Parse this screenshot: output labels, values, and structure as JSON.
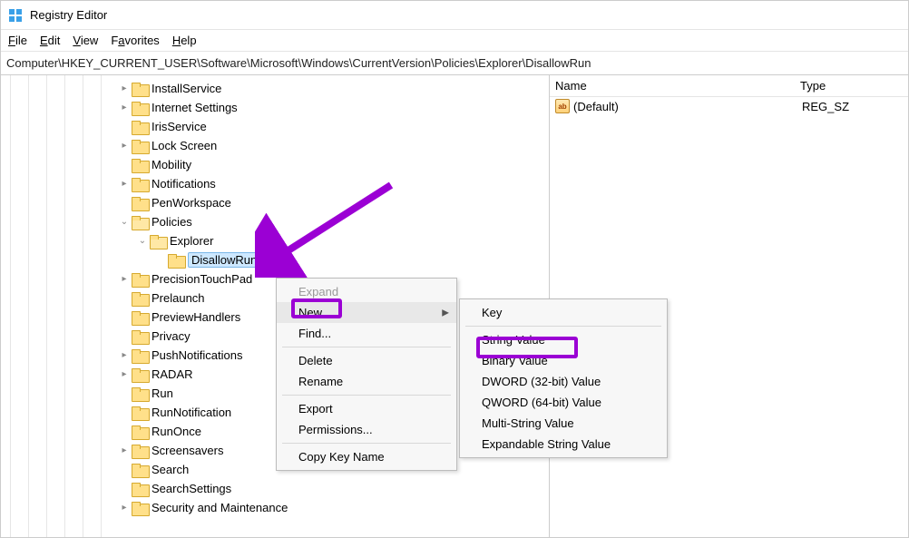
{
  "window": {
    "title": "Registry Editor"
  },
  "menubar": {
    "file": "File",
    "edit": "Edit",
    "view": "View",
    "favorites": "Favorites",
    "help": "Help"
  },
  "addressbar": {
    "path": "Computer\\HKEY_CURRENT_USER\\Software\\Microsoft\\Windows\\CurrentVersion\\Policies\\Explorer\\DisallowRun"
  },
  "tree": {
    "items": [
      {
        "label": "InstallService",
        "expand": "▸",
        "indent": 130
      },
      {
        "label": "Internet Settings",
        "expand": "▸",
        "indent": 130
      },
      {
        "label": "IrisService",
        "expand": "",
        "indent": 130
      },
      {
        "label": "Lock Screen",
        "expand": "▸",
        "indent": 130
      },
      {
        "label": "Mobility",
        "expand": "",
        "indent": 130
      },
      {
        "label": "Notifications",
        "expand": "▸",
        "indent": 130
      },
      {
        "label": "PenWorkspace",
        "expand": "",
        "indent": 130
      },
      {
        "label": "Policies",
        "expand": "⌄",
        "indent": 130,
        "open": true
      },
      {
        "label": "Explorer",
        "expand": "⌄",
        "indent": 150,
        "open": true
      },
      {
        "label": "DisallowRun",
        "expand": "",
        "indent": 170,
        "selected": true
      },
      {
        "label": "PrecisionTouchPad",
        "expand": "▸",
        "indent": 130
      },
      {
        "label": "Prelaunch",
        "expand": "",
        "indent": 130
      },
      {
        "label": "PreviewHandlers",
        "expand": "",
        "indent": 130
      },
      {
        "label": "Privacy",
        "expand": "",
        "indent": 130
      },
      {
        "label": "PushNotifications",
        "expand": "▸",
        "indent": 130
      },
      {
        "label": "RADAR",
        "expand": "▸",
        "indent": 130
      },
      {
        "label": "Run",
        "expand": "",
        "indent": 130
      },
      {
        "label": "RunNotification",
        "expand": "",
        "indent": 130
      },
      {
        "label": "RunOnce",
        "expand": "",
        "indent": 130
      },
      {
        "label": "Screensavers",
        "expand": "▸",
        "indent": 130
      },
      {
        "label": "Search",
        "expand": "",
        "indent": 130
      },
      {
        "label": "SearchSettings",
        "expand": "",
        "indent": 130
      },
      {
        "label": "Security and Maintenance",
        "expand": "▸",
        "indent": 130
      }
    ]
  },
  "values": {
    "header": {
      "name": "Name",
      "type": "Type"
    },
    "rows": [
      {
        "icon": "ab",
        "name": "(Default)",
        "type": "REG_SZ"
      }
    ]
  },
  "ctx1": {
    "expand": "Expand",
    "new": "New",
    "find": "Find...",
    "delete": "Delete",
    "rename": "Rename",
    "export": "Export",
    "permissions": "Permissions...",
    "copykey": "Copy Key Name"
  },
  "ctx2": {
    "key": "Key",
    "string": "String Value",
    "binary": "Binary Value",
    "dword": "DWORD (32-bit) Value",
    "qword": "QWORD (64-bit) Value",
    "multi": "Multi-String Value",
    "expandable": "Expandable String Value"
  }
}
